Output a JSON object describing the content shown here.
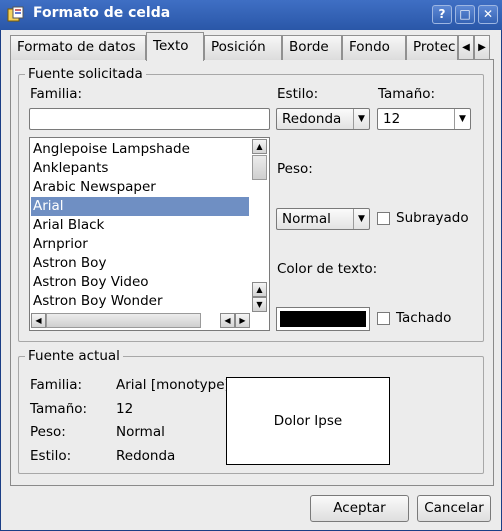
{
  "window": {
    "title": "Formato de celda",
    "controls": {
      "help": "?",
      "maximize": "□",
      "close": "✕"
    }
  },
  "tabs": [
    {
      "label": "Formato de datos",
      "active": false
    },
    {
      "label": "Texto",
      "active": true
    },
    {
      "label": "Posición",
      "active": false
    },
    {
      "label": "Borde",
      "active": false
    },
    {
      "label": "Fondo",
      "active": false
    },
    {
      "label": "Protec",
      "active": false
    }
  ],
  "tab_scroll": {
    "left": "◀",
    "right": "▶"
  },
  "requested_font": {
    "group_title": "Fuente solicitada",
    "family_label": "Familia:",
    "family_value": "",
    "style_label": "Estilo:",
    "style_value": "Redonda",
    "size_label": "Tamaño:",
    "size_value": "12",
    "weight_label": "Peso:",
    "weight_value": "Normal",
    "underline_label": "Subrayado",
    "underline_checked": false,
    "color_label": "Color de texto:",
    "color_value": "#000000",
    "strike_label": "Tachado",
    "strike_checked": false,
    "font_list": [
      "Anglepoise Lampshade",
      "Anklepants",
      "Arabic Newspaper",
      "Arial",
      "Arial Black",
      "Arnprior",
      "Astron Boy",
      "Astron Boy Video",
      "Astron Boy Wonder"
    ],
    "selected_font": "Arial"
  },
  "current_font": {
    "group_title": "Fuente actual",
    "family_label": "Familia:",
    "family_value": "Arial [monotype]",
    "size_label": "Tamaño:",
    "size_value": "12",
    "weight_label": "Peso:",
    "weight_value": "Normal",
    "style_label": "Estilo:",
    "style_value": "Redonda",
    "preview_text": "Dolor Ipse"
  },
  "buttons": {
    "ok": "Aceptar",
    "cancel": "Cancelar"
  }
}
